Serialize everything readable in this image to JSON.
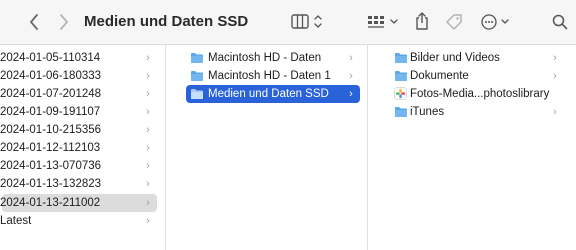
{
  "window": {
    "title": "Medien und Daten SSD"
  },
  "toolbar": {
    "back_icon": "chevron-left-icon",
    "forward_icon": "chevron-right-icon",
    "view_icon": "column-view-icon",
    "group_icon": "group-grid-icon",
    "share_icon": "share-icon",
    "tag_icon": "tag-icon",
    "more_icon": "ellipsis-circle-icon",
    "search_icon": "search-icon"
  },
  "colors": {
    "selection_active": "#2962d9",
    "selection_inactive": "#dcdcdc",
    "folder": "#5aa6e8"
  },
  "column1": {
    "items": [
      {
        "label": "2024-01-05-110314",
        "has_children": true
      },
      {
        "label": "2024-01-06-180333",
        "has_children": true
      },
      {
        "label": "2024-01-07-201248",
        "has_children": true
      },
      {
        "label": "2024-01-09-191107",
        "has_children": true
      },
      {
        "label": "2024-01-10-215356",
        "has_children": true
      },
      {
        "label": "2024-01-12-112103",
        "has_children": true
      },
      {
        "label": "2024-01-13-070736",
        "has_children": true
      },
      {
        "label": "2024-01-13-132823",
        "has_children": true
      },
      {
        "label": "2024-01-13-211002",
        "has_children": true,
        "selected": true
      },
      {
        "label": "Latest",
        "has_children": true
      }
    ]
  },
  "column2": {
    "items": [
      {
        "label": "Macintosh HD - Daten",
        "icon": "drive-folder-icon",
        "has_children": true
      },
      {
        "label": "Macintosh HD - Daten 1",
        "icon": "drive-folder-icon",
        "has_children": true
      },
      {
        "label": "Medien und Daten SSD",
        "icon": "drive-folder-icon",
        "has_children": true,
        "selected": true
      }
    ]
  },
  "column3": {
    "items": [
      {
        "label": "Bilder und Videos",
        "icon": "folder-icon",
        "has_children": true
      },
      {
        "label": "Dokumente",
        "icon": "folder-icon",
        "has_children": true
      },
      {
        "label": "Fotos-Media...photoslibrary",
        "icon": "photos-library-icon",
        "has_children": false
      },
      {
        "label": "iTunes",
        "icon": "folder-icon",
        "has_children": true
      }
    ]
  },
  "glyphs": {
    "chevron": "›"
  }
}
